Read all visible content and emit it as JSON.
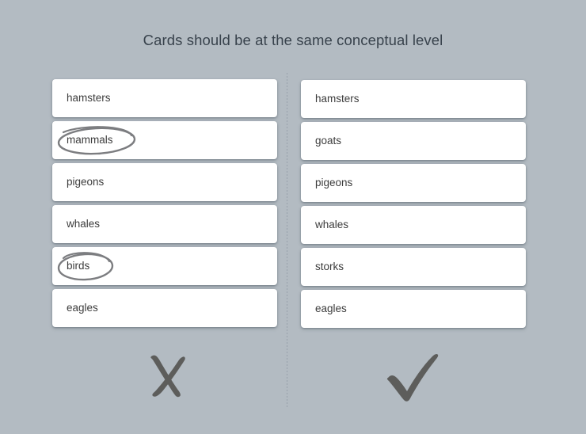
{
  "slide": {
    "title": "Cards should be at the same conceptual level",
    "background_color": "#b3bbc2",
    "title_color": "#38424c",
    "card_color": "#ffffff",
    "annotation_color": "#77787a",
    "mark_color": "#5d5d5b"
  },
  "columns": [
    {
      "id": "bad-example",
      "verdict_icon": "cross-mark-icon",
      "cards": [
        {
          "label": "hamsters",
          "annotated": false
        },
        {
          "label": "mammals",
          "annotated": true
        },
        {
          "label": "pigeons",
          "annotated": false
        },
        {
          "label": "whales",
          "annotated": false
        },
        {
          "label": "birds",
          "annotated": true
        },
        {
          "label": "eagles",
          "annotated": false
        }
      ]
    },
    {
      "id": "good-example",
      "verdict_icon": "check-mark-icon",
      "cards": [
        {
          "label": "hamsters",
          "annotated": false
        },
        {
          "label": "goats",
          "annotated": false
        },
        {
          "label": "pigeons",
          "annotated": false
        },
        {
          "label": "whales",
          "annotated": false
        },
        {
          "label": "storks",
          "annotated": false
        },
        {
          "label": "eagles",
          "annotated": false
        }
      ]
    }
  ]
}
